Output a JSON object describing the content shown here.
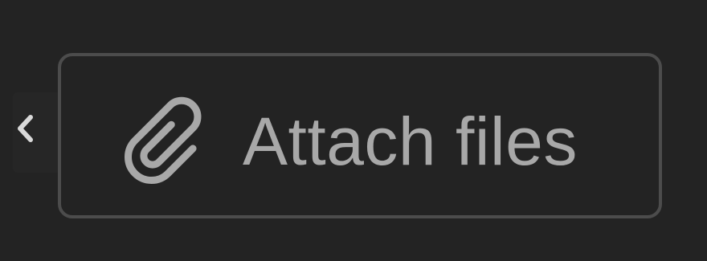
{
  "attach_button": {
    "label": "Attach files",
    "icon": "paperclip-icon"
  },
  "back_button": {
    "icon": "chevron-left-icon"
  },
  "colors": {
    "background": "#232323",
    "border": "#4c4c4c",
    "text": "#a8a8a8",
    "chevron": "#d9d9d9"
  }
}
